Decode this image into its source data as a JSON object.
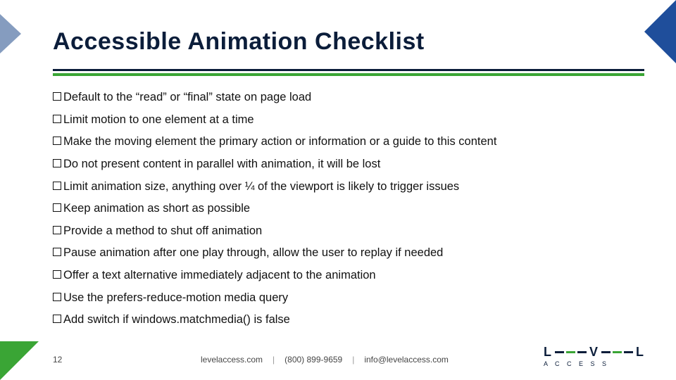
{
  "title": "Accessible Animation Checklist",
  "items": [
    "Default to the “read” or “final” state on page load",
    "Limit motion to one element at a time",
    "Make the moving element the primary action or information or a guide to this content",
    "Do not present content in parallel with animation, it will be lost",
    "Limit animation size, anything over ¼ of the viewport is likely to trigger issues",
    "Keep animation as short as possible",
    "Provide a method to shut off animation",
    "Pause animation after one play through, allow the user to replay if needed",
    "Offer a text alternative immediately adjacent to the animation",
    "Use the prefers-reduce-motion media query",
    "Add switch if windows.matchmedia() is false"
  ],
  "footer": {
    "page": "12",
    "site": "levelaccess.com",
    "phone": "(800) 899-9659",
    "email": "info@levelaccess.com"
  },
  "logo": {
    "l1": "L",
    "vel": "V",
    "l2": "L",
    "sub": "A C C E S S"
  }
}
